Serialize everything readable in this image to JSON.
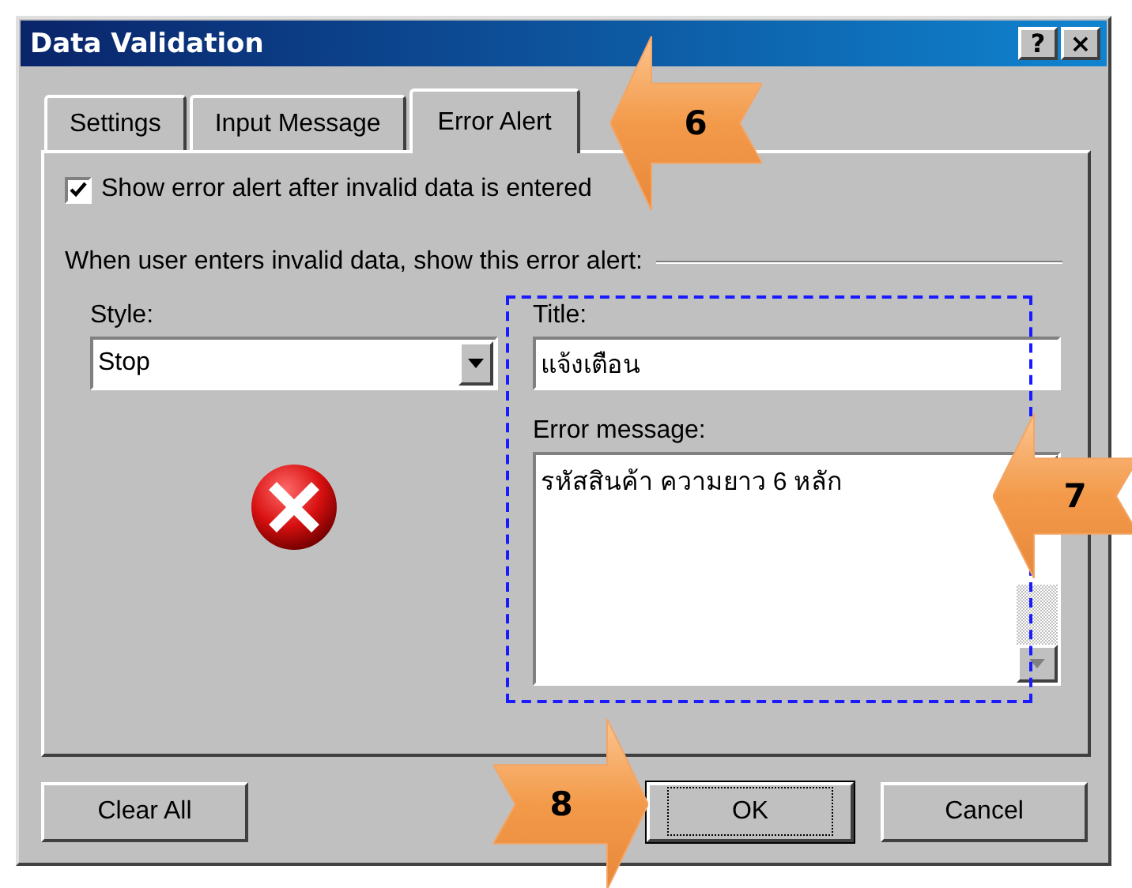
{
  "window": {
    "title": "Data Validation",
    "help_button": "?",
    "close_button": "×"
  },
  "tabs": [
    {
      "label": "Settings",
      "selected": false
    },
    {
      "label": "Input Message",
      "selected": false
    },
    {
      "label": "Error Alert",
      "selected": true
    }
  ],
  "show_alert": {
    "label": "Show error alert after invalid data is entered",
    "checked": true
  },
  "group_label": "When user enters invalid data, show this error alert:",
  "style": {
    "label": "Style:",
    "value": "Stop"
  },
  "title_field": {
    "label": "Title:",
    "value": "แจ้งเตือน"
  },
  "message_field": {
    "label": "Error message:",
    "value": "รหัสสินค้า ความยาว 6 หลัก"
  },
  "buttons": [
    {
      "label": "Clear All",
      "default": false
    },
    {
      "label": "OK",
      "default": true
    },
    {
      "label": "Cancel",
      "default": false
    }
  ],
  "callouts": [
    {
      "number": "6",
      "kind": "left"
    },
    {
      "number": "7",
      "kind": "left"
    },
    {
      "number": "8",
      "kind": "right"
    }
  ]
}
